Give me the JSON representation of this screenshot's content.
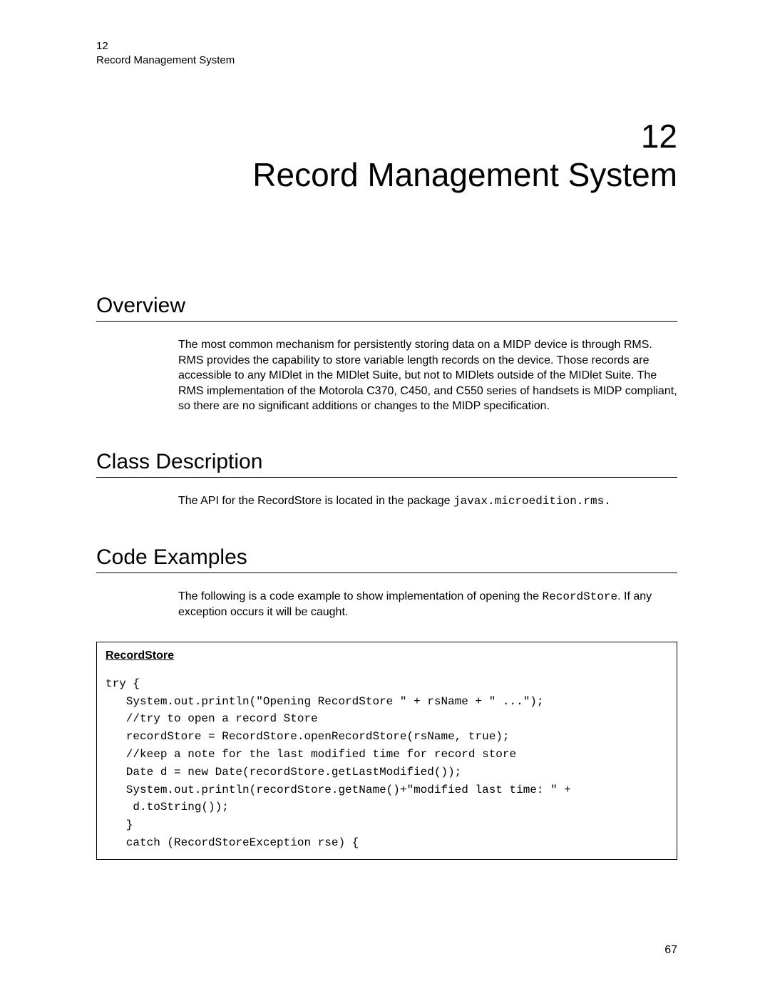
{
  "header": {
    "chapter_num_small": "12",
    "running_title": "Record Management System"
  },
  "chapter": {
    "number": "12",
    "title": "Record Management System"
  },
  "sections": {
    "overview": {
      "heading": "Overview",
      "body": "The most common mechanism for persistently storing data on a MIDP device is through RMS. RMS provides the capability to store variable length records on the device. Those records are accessible to any MIDlet in the MIDlet Suite, but not to MIDlets outside of the MIDlet Suite. The RMS implementation of the Motorola C370, C450, and C550 series of handsets is MIDP compliant, so there are no significant additions or changes to the MIDP specification."
    },
    "class_description": {
      "heading": "Class Description",
      "body_prefix": "The API for the RecordStore is located in the package ",
      "body_code": "javax.microedition.rms.",
      "body_suffix": ""
    },
    "code_examples": {
      "heading": "Code Examples",
      "intro_prefix": "The following is a code example to show implementation of opening the ",
      "intro_code": "RecordStore",
      "intro_suffix": ". If any exception occurs it will be caught.",
      "code_title": "RecordStore",
      "code": "try {\n   System.out.println(\"Opening RecordStore \" + rsName + \" ...\");\n   //try to open a record Store\n   recordStore = RecordStore.openRecordStore(rsName, true);\n   //keep a note for the last modified time for record store\n   Date d = new Date(recordStore.getLastModified());\n   System.out.println(recordStore.getName()+\"modified last time: \" +\n    d.toString());\n   }\n   catch (RecordStoreException rse) {"
    }
  },
  "page_number": "67"
}
